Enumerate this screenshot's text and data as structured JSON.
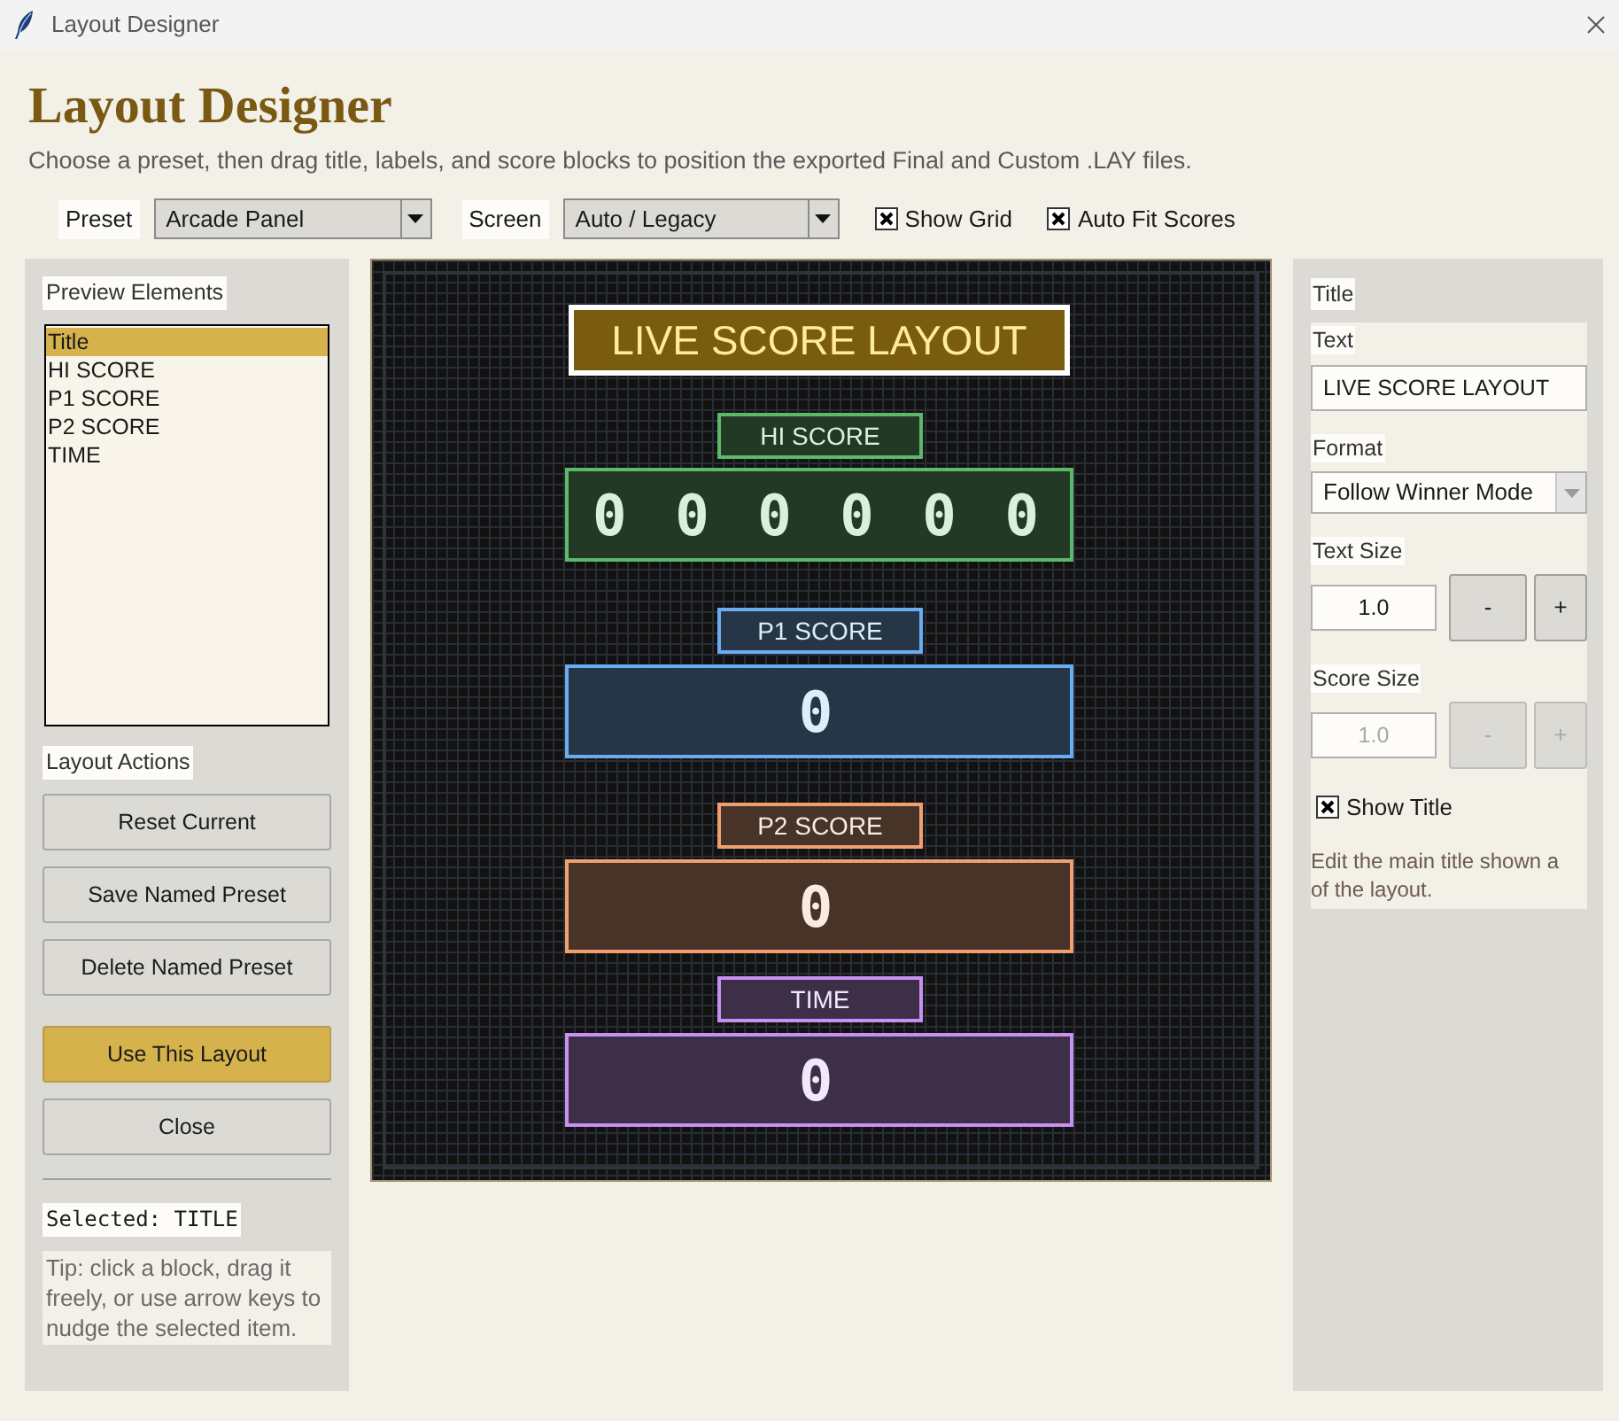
{
  "window": {
    "title": "Layout Designer"
  },
  "header": {
    "title": "Layout Designer",
    "subtitle": "Choose a preset, then drag title, labels, and score blocks to position the exported Final and Custom .LAY files."
  },
  "toolbar": {
    "dropdowns": [
      {
        "label": "Preset",
        "value": "Arcade Panel"
      },
      {
        "label": "Screen",
        "value": "Auto / Legacy"
      }
    ],
    "checkboxes": [
      {
        "label": "Show Grid",
        "checked": true
      },
      {
        "label": "Auto Fit Scores",
        "checked": true
      }
    ]
  },
  "preview_elements": {
    "heading": "Preview Elements",
    "items": [
      {
        "label": "Title",
        "selected": true
      },
      {
        "label": "HI SCORE",
        "selected": false
      },
      {
        "label": "P1 SCORE",
        "selected": false
      },
      {
        "label": "P2 SCORE",
        "selected": false
      },
      {
        "label": "TIME",
        "selected": false
      }
    ]
  },
  "layout_actions": {
    "heading": "Layout Actions",
    "buttons": [
      {
        "label": "Reset Current",
        "kind": "normal"
      },
      {
        "label": "Save Named Preset",
        "kind": "normal"
      },
      {
        "label": "Delete Named Preset",
        "kind": "normal"
      },
      {
        "label": "Use This Layout",
        "kind": "primary"
      },
      {
        "label": "Close",
        "kind": "normal"
      }
    ]
  },
  "selected_status": "Selected: TITLE",
  "tip": "Tip: click a block, drag it freely, or use arrow keys to nudge the selected item.",
  "canvas": {
    "title": "LIVE SCORE LAYOUT",
    "blocks": [
      {
        "label": "HI SCORE",
        "value": "0 0 0 0 0 0",
        "color": "#5cb86a"
      },
      {
        "label": "P1 SCORE",
        "value": "0",
        "color": "#6aacf0"
      },
      {
        "label": "P2 SCORE",
        "value": "0",
        "color": "#f0a070"
      },
      {
        "label": "TIME",
        "value": "0",
        "color": "#c890f0"
      }
    ]
  },
  "properties": {
    "heading": "Title",
    "fields": [
      {
        "kind": "text",
        "label": "Text",
        "value": "LIVE SCORE LAYOUT"
      },
      {
        "kind": "select",
        "label": "Format",
        "value": "Follow Winner Mode"
      },
      {
        "kind": "stepper",
        "label": "Text Size",
        "value": "1.0",
        "minus": "-",
        "plus": "+",
        "disabled": false
      },
      {
        "kind": "stepper",
        "label": "Score Size",
        "value": "1.0",
        "minus": "-",
        "plus": "+",
        "disabled": true
      },
      {
        "kind": "checkbox",
        "label": "Show Title",
        "checked": true
      }
    ],
    "description": "Edit the main title shown a\nof the layout."
  }
}
